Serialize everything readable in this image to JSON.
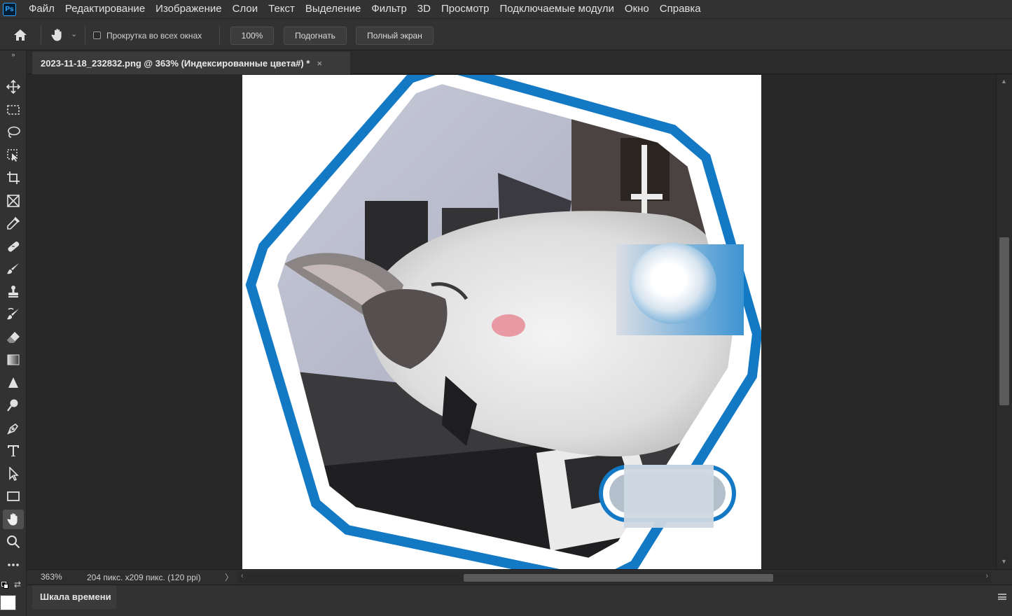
{
  "app": {
    "logo_text": "Ps"
  },
  "menu": [
    "Файл",
    "Редактирование",
    "Изображение",
    "Слои",
    "Текст",
    "Выделение",
    "Фильтр",
    "3D",
    "Просмотр",
    "Подключаемые модули",
    "Окно",
    "Справка"
  ],
  "options_bar": {
    "scroll_all_label": "Прокрутка во всех окнах",
    "zoom_100_label": "100%",
    "fit_label": "Подогнать",
    "fullscreen_label": "Полный экран"
  },
  "document": {
    "tab_title": "2023-11-18_232832.png @ 363% (Индексированные цвета#) *",
    "close_glyph": "×"
  },
  "status": {
    "zoom": "363%",
    "info": "204 пикс. x209 пикс. (120 ppi)",
    "more": "〉"
  },
  "panels": {
    "timeline_label": "Шкала времени"
  },
  "tools": [
    "move-tool",
    "marquee-tool",
    "lasso-tool",
    "object-select-tool",
    "crop-tool",
    "frame-tool",
    "eyedropper-tool",
    "healing-tool",
    "brush-tool",
    "stamp-tool",
    "history-brush-tool",
    "eraser-tool",
    "gradient-tool",
    "blur-tool",
    "dodge-tool",
    "pen-tool",
    "type-tool",
    "path-select-tool",
    "rectangle-tool",
    "hand-tool",
    "zoom-tool",
    "more-tools"
  ],
  "colors": {
    "accent": "#31a8ff",
    "frame_blue": "#1379c4",
    "foreground": "#ffffff",
    "background": "#ffffff"
  }
}
